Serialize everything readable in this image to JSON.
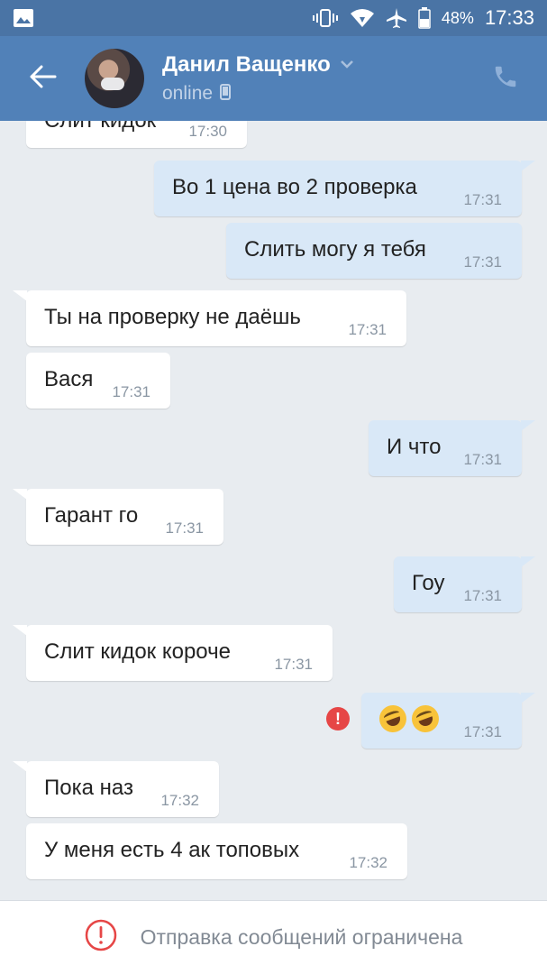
{
  "status_bar": {
    "battery": "48%",
    "time": "17:33",
    "icons": [
      "image-icon",
      "vibrate-icon",
      "wifi-icon",
      "airplane-icon",
      "battery-icon"
    ]
  },
  "header": {
    "contact_name": "Данил Ващенко",
    "status": "online",
    "icons": [
      "back-arrow-icon",
      "chevron-down-icon",
      "mobile-icon",
      "phone-icon"
    ]
  },
  "messages": [
    {
      "dir": "in",
      "text": "Слит кидок",
      "time": "17:30"
    },
    {
      "dir": "out",
      "text": "Во 1 цена во 2 проверка",
      "time": "17:31"
    },
    {
      "dir": "out",
      "text": "Слить могу я тебя",
      "time": "17:31"
    },
    {
      "dir": "in",
      "text": "Ты на проверку не даёшь",
      "time": "17:31"
    },
    {
      "dir": "in",
      "text": "Вася",
      "time": "17:31"
    },
    {
      "dir": "out",
      "text": "И что",
      "time": "17:31"
    },
    {
      "dir": "in",
      "text": "Гарант го",
      "time": "17:31"
    },
    {
      "dir": "out",
      "text": "Гоу",
      "time": "17:31"
    },
    {
      "dir": "in",
      "text": "Слит кидок короче",
      "time": "17:31"
    },
    {
      "dir": "out",
      "text": "",
      "emoji": [
        "rofl-emoji",
        "rofl-emoji"
      ],
      "error": true,
      "time": "17:31"
    },
    {
      "dir": "in",
      "text": "Пока наз",
      "time": "17:32"
    },
    {
      "dir": "in",
      "text": "У меня есть 4 ак топовых",
      "time": "17:32"
    }
  ],
  "bottom_bar": {
    "text": "Отправка сообщений ограничена",
    "icon": "alert-circle-icon"
  },
  "colors": {
    "header": "#5181b8",
    "status_bar": "#4a74a5",
    "background": "#e8ecf0",
    "incoming": "#ffffff",
    "outgoing": "#d9e8f7",
    "error": "#e64646"
  }
}
